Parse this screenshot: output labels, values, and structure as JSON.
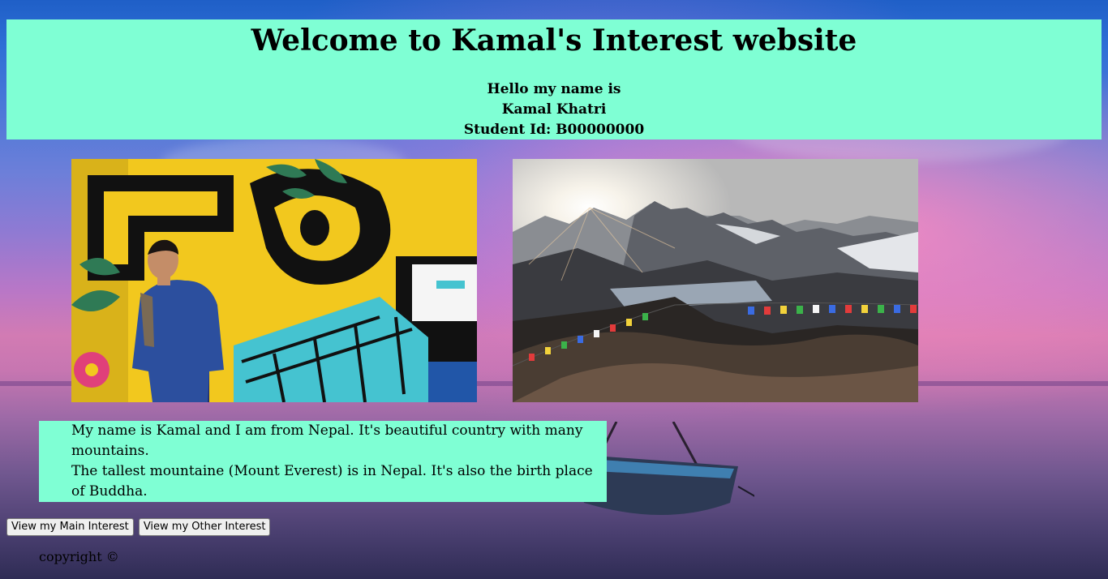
{
  "header": {
    "title": "Welcome to Kamal's Interest website",
    "greeting": "Hello my name is",
    "name": "Kamal Khatri",
    "student_id": "Student Id: B00000000"
  },
  "images": {
    "left_icon": "person-with-mural-photo",
    "right_icon": "mountain-sunrise-photo"
  },
  "about": {
    "line1": "My name is Kamal and I am from Nepal. It's beautiful country with many mountains.",
    "line2": "The tallest mountaine (Mount Everest) is in Nepal. It's also the birth place of Buddha."
  },
  "buttons": {
    "main_interest": "View my Main Interest",
    "other_interest": "View my Other Interest"
  },
  "footer": {
    "copyright": "copyright ©"
  },
  "colors": {
    "panel": "#7fffd4"
  }
}
